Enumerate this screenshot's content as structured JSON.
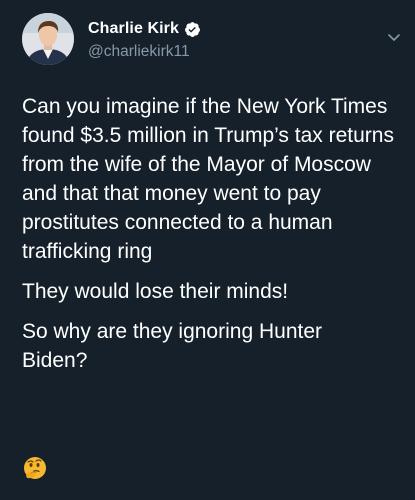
{
  "author": {
    "display_name": "Charlie Kirk",
    "handle": "@charliekirk11",
    "verified": true,
    "avatar_icon": "profile-photo"
  },
  "tweet": {
    "paragraphs": [
      "Can you imagine if the New York Times found $3.5 million in Trump’s tax returns from the wife of the Mayor of Moscow and that that money went to pay prostitutes connected to a human trafficking ring",
      "They would lose their minds!",
      "So why are they ignoring Hunter Biden?"
    ],
    "emoji": "thinking-face-icon"
  },
  "menu": {
    "icon": "chevron-down-icon"
  },
  "colors": {
    "background": "#15202b",
    "text": "#ffffff",
    "secondary_text": "#8899a6",
    "verified_badge": "#ffffff"
  }
}
